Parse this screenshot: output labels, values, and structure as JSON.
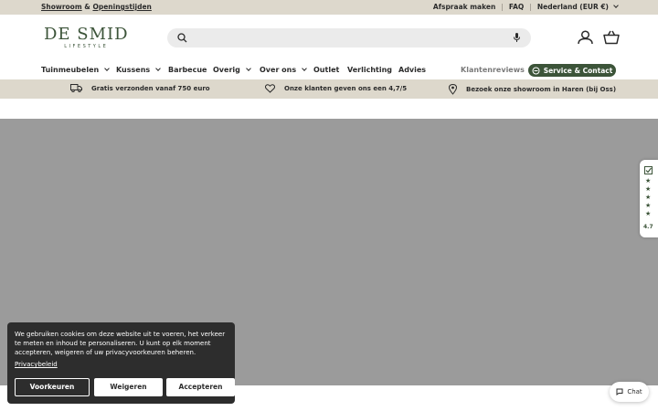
{
  "topbar": {
    "showroom": "Showroom",
    "amp": "&",
    "hours": "Openingstijden",
    "appointment": "Afspraak maken",
    "sep": "|",
    "faq": "FAQ",
    "region": "Nederland (EUR €)"
  },
  "logo": {
    "main": "DE SMID",
    "sub": "LIFESTYLE"
  },
  "search": {
    "placeholder": "",
    "value": ""
  },
  "nav": {
    "items": [
      "Tuinmeubelen",
      "Kussens",
      "Barbecue",
      "Overig",
      "Over ons",
      "Outlet",
      "Verlichting",
      "Advies"
    ],
    "reviews": "Klantenreviews",
    "service": "Service & Contact"
  },
  "usp": {
    "shipping": "Gratis verzonden vanaf 750 euro",
    "rating": "Onze klanten geven ons een 4,7/5",
    "showroom": "Bezoek onze showroom in Haren (bij Oss)"
  },
  "review_widget": {
    "score": "4.7"
  },
  "cookie": {
    "text": "We gebruiken cookies om deze website uit te voeren, het verkeer te meten en inhoud te personaliseren. U kunt op elk moment accepteren, weigeren of uw privacyvoorkeuren beheren.",
    "privacy": "Privacybeleid",
    "preferences": "Voorkeuren",
    "deny": "Weigeren",
    "accept": "Accepteren"
  },
  "chat": {
    "label": "Chat"
  },
  "colors": {
    "brand": "#3c5439",
    "sand": "#ddd8cc",
    "hero": "#9b9b9b"
  }
}
